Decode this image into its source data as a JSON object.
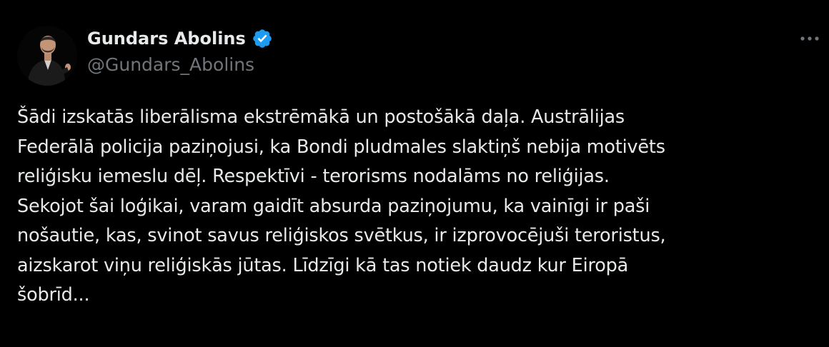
{
  "author": {
    "display_name": "Gundars Abolins",
    "handle": "@Gundars_Abolins",
    "verified": true,
    "verified_color": "#1d9bf0"
  },
  "tweet": {
    "text": "Šādi izskatās liberālisma ekstrēmākā un postošākā daļa. Austrālijas\nFederālā policija paziņojusi, ka Bondi pludmales slaktiņš nebija motivēts\nreliģisku iemeslu dēļ. Respektīvi - terorisms nodalāms no reliģijas.\nSekojot šai loģikai, varam gaidīt absurda paziņojumu, ka vainīgi ir paši\nnošautie, kas, svinot savus reliģiskos svētkus, ir izprovocējuši teroristus,\naizskarot viņu reliģiskās jūtas. Līdzīgi kā tas notiek daudz kur Eiropā\nšobrīd..."
  },
  "icons": {
    "verified": "verified-badge-icon",
    "more": "more-horizontal-icon"
  },
  "colors": {
    "background": "#000000",
    "text": "#e7e9ea",
    "secondary": "#71767b"
  }
}
